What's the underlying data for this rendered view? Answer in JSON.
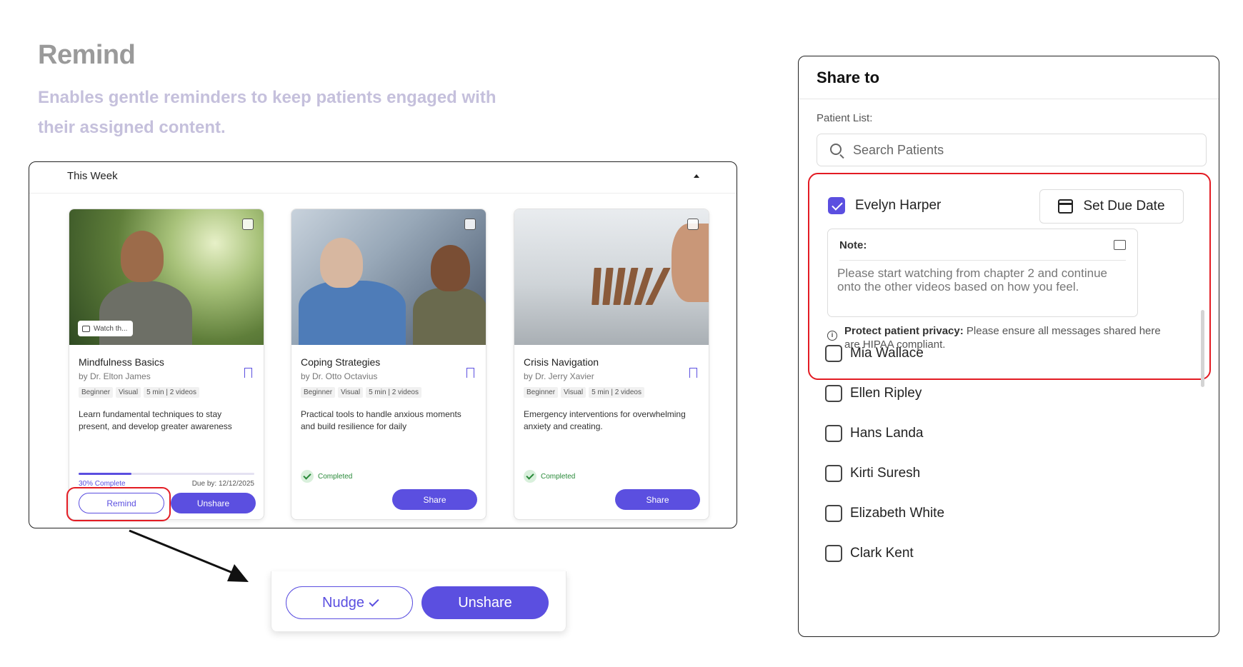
{
  "intro": {
    "heading": "Remind",
    "subtitle": "Enables gentle reminders to keep patients engaged with their assigned content."
  },
  "week": {
    "title": "This Week",
    "cards": [
      {
        "title": "Mindfulness Basics",
        "author": "by Dr. Elton James",
        "tags": [
          "Beginner",
          "Visual",
          "5 min | 2 videos"
        ],
        "description": "Learn fundamental techniques to stay present, and develop greater awareness",
        "watch_chip": "Watch th...",
        "progress": 0.3,
        "progress_label": "30% Complete",
        "due": "Due by: 12/12/2025",
        "remind_label": "Remind",
        "unshare_label": "Unshare"
      },
      {
        "title": "Coping Strategies",
        "author": "by Dr. Otto Octavius",
        "tags": [
          "Beginner",
          "Visual",
          "5 min | 2 videos"
        ],
        "description": "Practical tools to handle anxious moments and build resilience for daily",
        "status": "Completed",
        "share_label": "Share"
      },
      {
        "title": "Crisis Navigation",
        "author": "by Dr. Jerry Xavier",
        "tags": [
          "Beginner",
          "Visual",
          "5 min | 2 videos"
        ],
        "description": "Emergency interventions for overwhelming anxiety and creating.",
        "status": "Completed",
        "share_label": "Share"
      }
    ]
  },
  "zoom": {
    "nudge_label": "Nudge",
    "unshare_label": "Unshare"
  },
  "share": {
    "title": "Share to",
    "patient_list_label": "Patient List:",
    "search_placeholder": "Search Patients",
    "selected": {
      "name": "Evelyn Harper",
      "checked": true,
      "due_button": "Set Due Date",
      "note_label": "Note:",
      "note_text": "Please start watching from chapter 2 and continue onto the other videos based on how you feel.",
      "privacy_bold": "Protect patient privacy:",
      "privacy_text": " Please ensure all messages shared here are HIPAA compliant."
    },
    "patients": [
      "Mia Wallace",
      "Ellen Ripley",
      "Hans Landa",
      "Kirti Suresh",
      "Elizabeth White",
      "Clark Kent"
    ]
  },
  "colors": {
    "accent": "#5b4fe0",
    "highlight": "#e31b23",
    "heading": "#9a9a9a",
    "subtitle": "#c5c0dc",
    "completed": "#2a8a3a"
  },
  "icons": [
    "chevron-up-icon",
    "bookmark-icon",
    "chat-icon",
    "check-circle-icon",
    "search-icon",
    "calendar-icon",
    "note-icon",
    "info-icon"
  ]
}
